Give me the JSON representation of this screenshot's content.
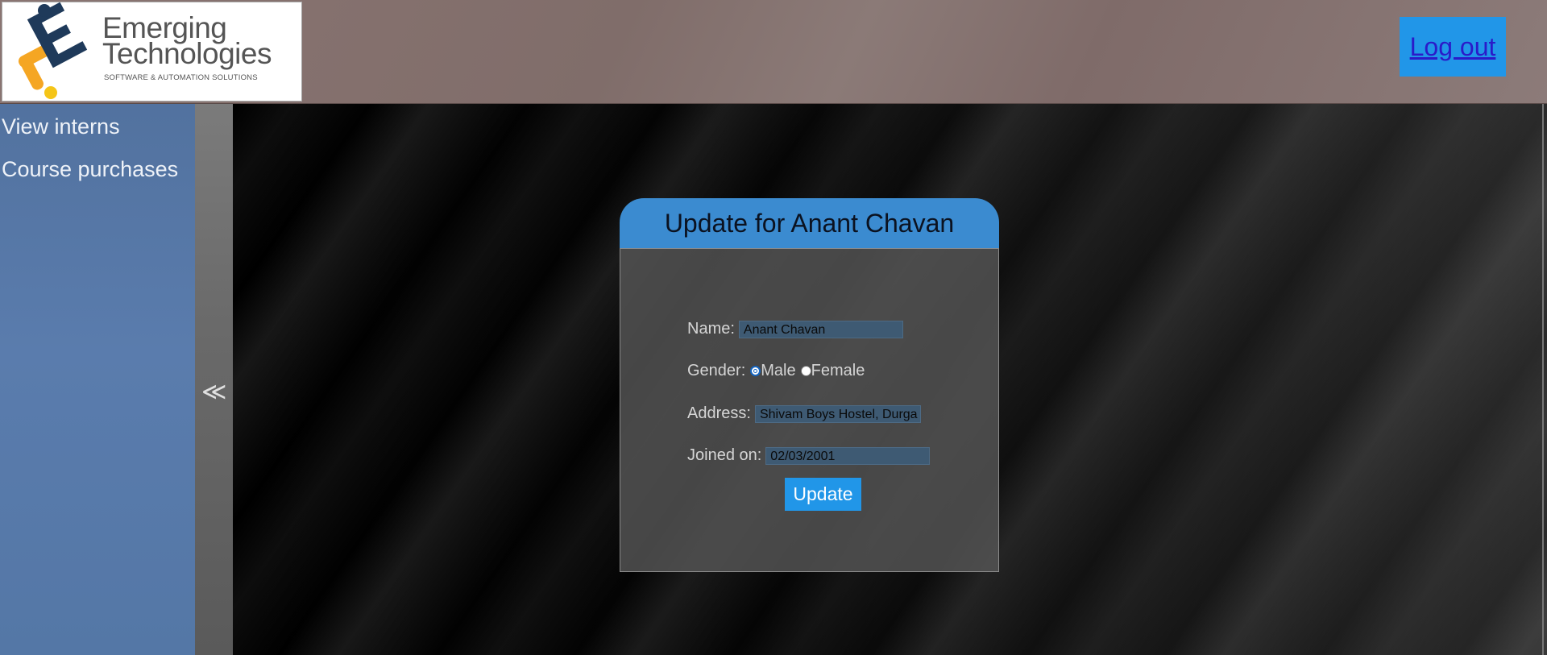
{
  "header": {
    "logo_line1": "Emerging",
    "logo_line2": "Technologies",
    "logo_tagline": "SOFTWARE & AUTOMATION SOLUTIONS",
    "logout_label": "Log out"
  },
  "sidebar": {
    "items": [
      {
        "label": "View interns"
      },
      {
        "label": "Course purchases"
      }
    ],
    "collapse_glyph": "≪"
  },
  "form": {
    "title": "Update for Anant Chavan",
    "name_label": "Name:",
    "name_value": "Anant Chavan",
    "gender_label": "Gender:",
    "gender_options": [
      "Male",
      "Female"
    ],
    "gender_selected": "Male",
    "address_label": "Address:",
    "address_value": "Shivam Boys Hostel, Durga",
    "joined_label": "Joined on:",
    "joined_value": "02/03/2001",
    "submit_label": "Update"
  },
  "colors": {
    "accent": "#2196e8",
    "card_header": "#3b8bd0",
    "sidebar": "#5a7cad",
    "header_bg": "#806d6a",
    "logo_orange": "#f5a623",
    "logo_navy": "#1f3a5a"
  }
}
